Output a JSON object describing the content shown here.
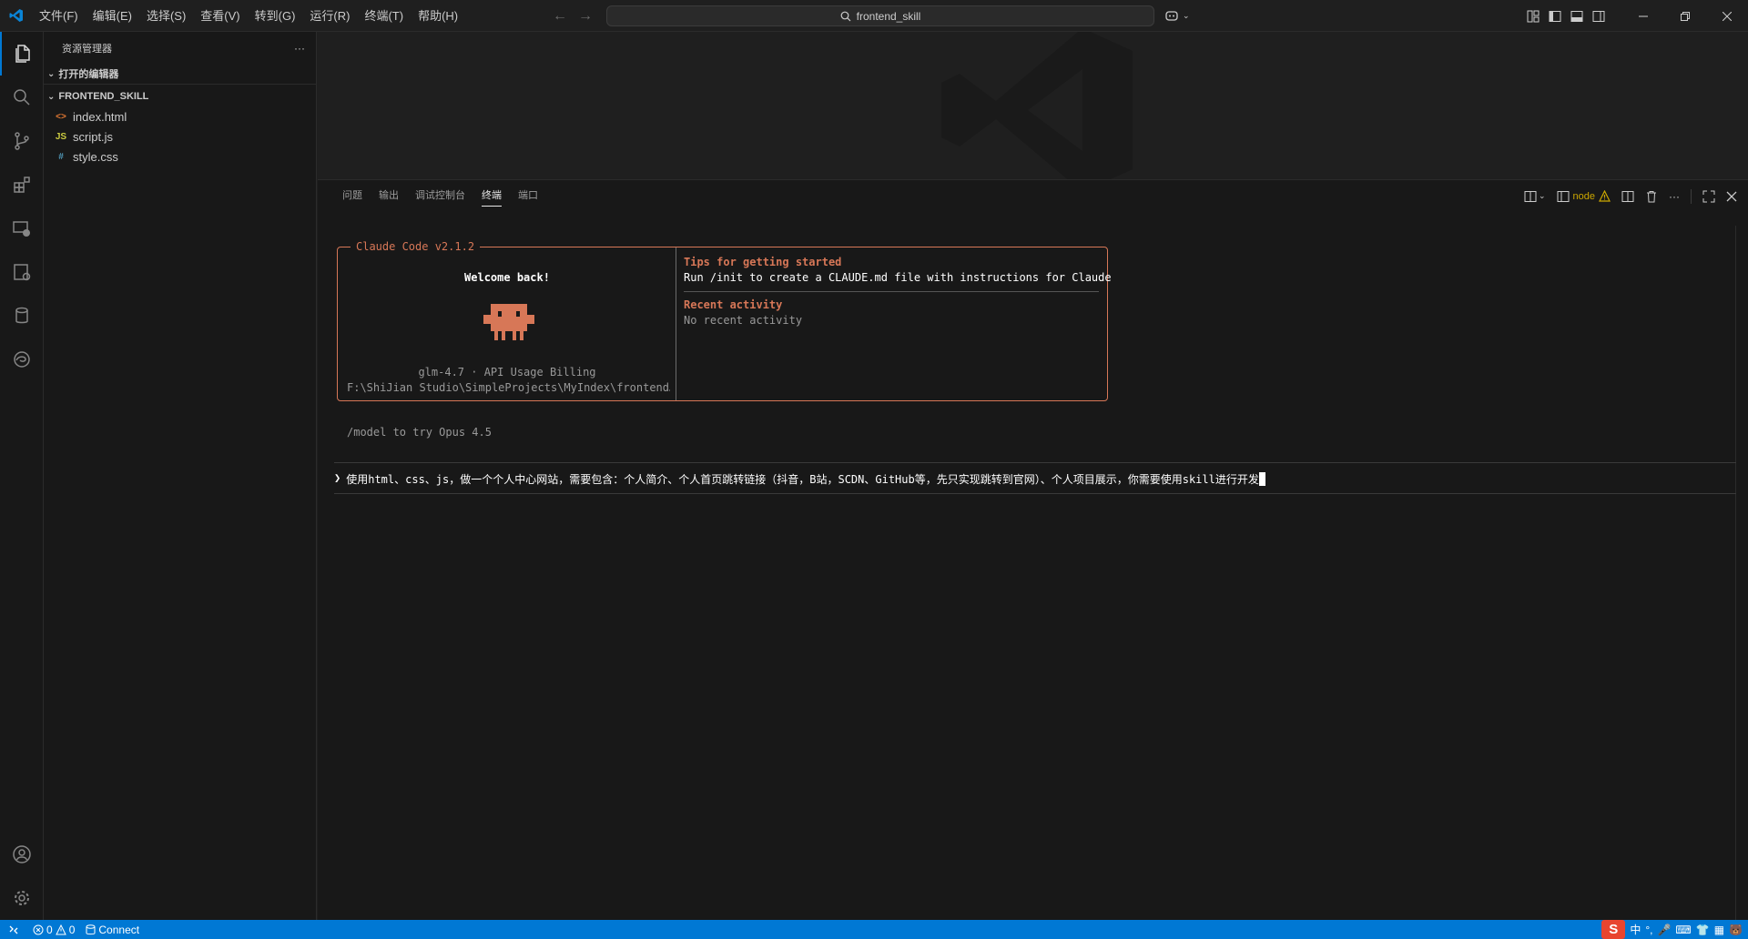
{
  "titlebar": {
    "menu": [
      "文件(F)",
      "编辑(E)",
      "选择(S)",
      "查看(V)",
      "转到(G)",
      "运行(R)",
      "终端(T)",
      "帮助(H)"
    ],
    "search_text": "frontend_skill"
  },
  "sidebar": {
    "title": "资源管理器",
    "more": "···",
    "open_editors": "打开的编辑器",
    "folder": "FRONTEND_SKILL",
    "files": [
      {
        "name": "index.html",
        "icon": "<>",
        "color": "#e37933"
      },
      {
        "name": "script.js",
        "icon": "JS",
        "color": "#cbcb41"
      },
      {
        "name": "style.css",
        "icon": "#",
        "color": "#519aba"
      }
    ]
  },
  "panel": {
    "tabs": [
      "问题",
      "输出",
      "调试控制台",
      "终端",
      "端口"
    ],
    "active_tab": "终端",
    "terminal_name": "node"
  },
  "terminal": {
    "box_title": "Claude Code v2.1.2",
    "welcome": "Welcome back!",
    "model": "glm-4.7 · API Usage Billing",
    "path": "F:\\ShiJian Studio\\SimpleProjects\\MyIndex\\frontend…",
    "tips_title": "Tips for getting started",
    "tips_text": "Run /init to create a CLAUDE.md file with instructions for Claude",
    "recent_title": "Recent activity",
    "recent_text": "No recent activity",
    "hint": "/model to try Opus 4.5",
    "prompt_caret": "❯",
    "prompt_text": "使用html、css、js，做一个个人中心网站，需要包含：个人简介、个人首页跳转链接（抖音，B站，SCDN、GitHub等，先只实现跳转到官网）、个人项目展示，你需要使用skill进行开发"
  },
  "statusbar": {
    "errors": "0",
    "warnings": "0",
    "connect": "Connect",
    "ime": [
      "S",
      "中",
      "°,",
      "🎤",
      "⌨",
      "👕",
      "▦",
      "🐻"
    ]
  },
  "colors": {
    "accent": "#0078d4",
    "claude": "#d77757",
    "warning": "#cca700"
  }
}
